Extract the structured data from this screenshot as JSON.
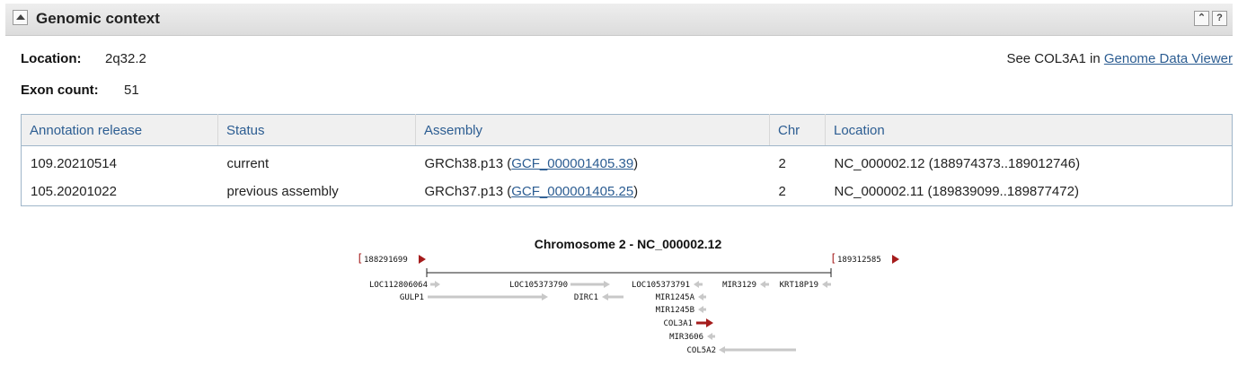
{
  "header": {
    "title": "Genomic context"
  },
  "summary": {
    "location_label": "Location:",
    "location_value": "2q32.2",
    "exon_label": "Exon count:",
    "exon_value": "51",
    "see_prefix": "See COL3A1 in",
    "see_link": "Genome Data Viewer"
  },
  "table": {
    "headers": [
      "Annotation release",
      "Status",
      "Assembly",
      "Chr",
      "Location"
    ],
    "rows": [
      {
        "release": "109.20210514",
        "status": "current",
        "assembly_name": "GRCh38.p13",
        "assembly_acc": "GCF_000001405.39",
        "chr": "2",
        "location": "NC_000002.12 (188974373..189012746)"
      },
      {
        "release": "105.20201022",
        "status": "previous assembly",
        "assembly_name": "GRCh37.p13",
        "assembly_acc": "GCF_000001405.25",
        "chr": "2",
        "location": "NC_000002.11 (189839099..189877472)"
      }
    ]
  },
  "graphic": {
    "title": "Chromosome 2 - NC_000002.12",
    "left_coord": "188291699",
    "right_coord": "189312585",
    "genes": {
      "loc112806064": "LOC112806064",
      "loc105373790": "LOC105373790",
      "loc105373791": "LOC105373791",
      "mir3129": "MIR3129",
      "krt18p19": "KRT18P19",
      "gulp1": "GULP1",
      "dirc1": "DIRC1",
      "mir1245a": "MIR1245A",
      "mir1245b": "MIR1245B",
      "col3a1": "COL3A1",
      "mir3606": "MIR3606",
      "col5a2": "COL5A2"
    },
    "colors": {
      "highlight": "#a51c1c",
      "neighbor": "#c8c8c8"
    }
  }
}
